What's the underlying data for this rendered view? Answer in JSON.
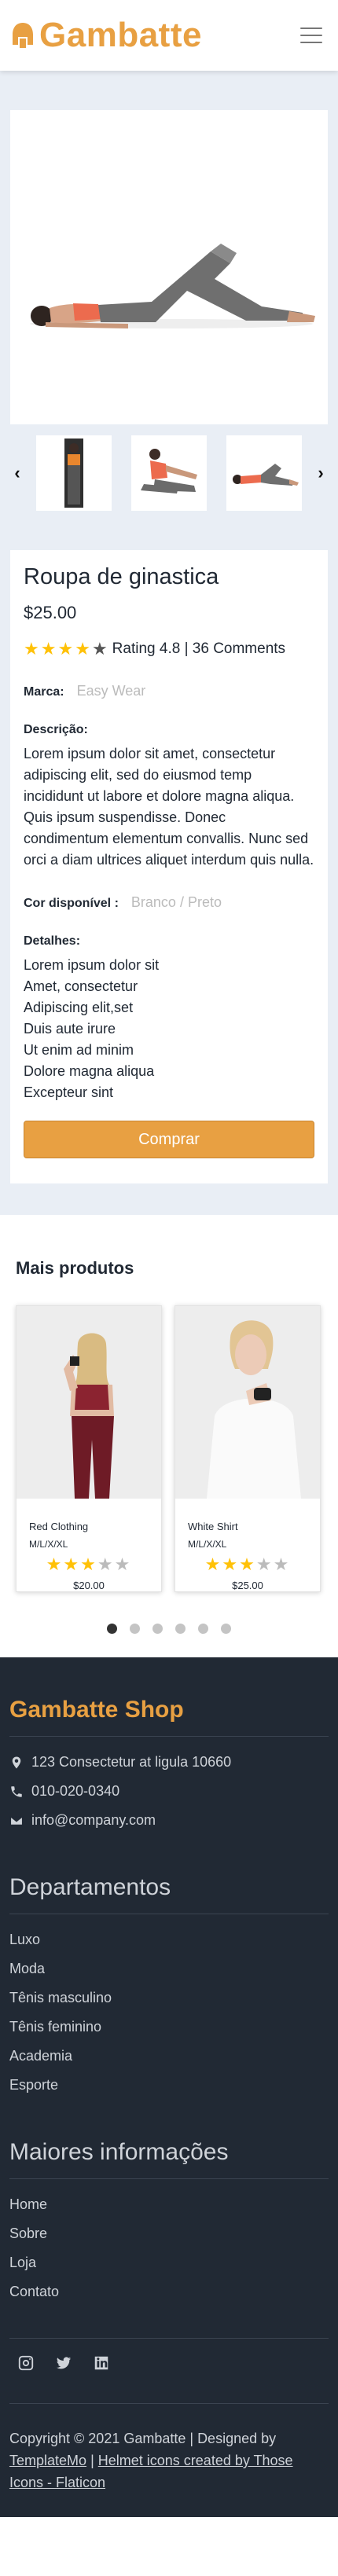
{
  "header": {
    "brand": "Gambatte",
    "menu_icon": "hamburger-icon"
  },
  "product": {
    "title": "Roupa de ginastica",
    "price": "$25.00",
    "rating": {
      "filled": 4,
      "total": 5,
      "text": "Rating 4.8 | 36 Comments"
    },
    "brand_label": "Marca:",
    "brand_value": "Easy Wear",
    "description_label": "Descrição:",
    "description": "Lorem ipsum dolor sit amet, consectetur adipiscing elit, sed do eiusmod temp incididunt ut labore et dolore magna aliqua. Quis ipsum suspendisse. Donec condimentum elementum convallis. Nunc sed orci a diam ultrices aliquet interdum quis nulla.",
    "color_label": "Cor disponível :",
    "color_value": "Branco / Preto",
    "details_label": "Detalhes:",
    "details": [
      "Lorem ipsum dolor sit",
      "Amet, consectetur",
      "Adipiscing elit,set",
      "Duis aute irure",
      "Ut enim ad minim",
      "Dolore magna aliqua",
      "Excepteur sint"
    ],
    "buy_button": "Comprar"
  },
  "more": {
    "title": "Mais produtos",
    "items": [
      {
        "name": "Red Clothing",
        "sizes": "M/L/X/XL",
        "stars": 3,
        "price": "$20.00"
      },
      {
        "name": "White Shirt",
        "sizes": "M/L/X/XL",
        "stars": 3,
        "price": "$25.00"
      }
    ],
    "dots_total": 6,
    "dots_active": 1
  },
  "footer": {
    "brand": "Gambatte Shop",
    "address": "123 Consectetur at ligula 10660",
    "phone": "010-020-0340",
    "email": "info@company.com",
    "departments_title": "Departamentos",
    "departments": [
      "Luxo",
      "Moda",
      "Tênis masculino",
      "Tênis feminino",
      "Academia",
      "Esporte"
    ],
    "info_title": "Maiores informações",
    "info_links": [
      "Home",
      "Sobre",
      "Loja",
      "Contato"
    ],
    "copyright_prefix": "Copyright © 2021 Gambatte | Designed by",
    "designer_link": "TemplateMo",
    "separator": "|",
    "credits_link": "Helmet icons created by Those Icons - Flaticon"
  },
  "colors": {
    "accent": "#e8a042",
    "footer_bg": "#212934",
    "product_bg": "#e9eef5",
    "star": "#ffc107"
  }
}
